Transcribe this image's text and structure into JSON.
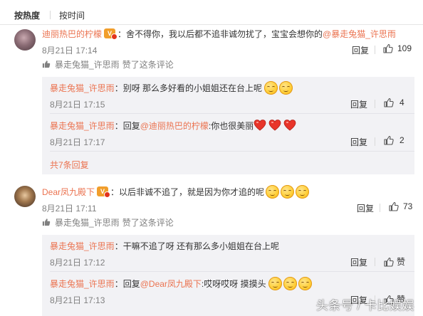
{
  "sort_tabs": [
    {
      "label": "按热度",
      "active": true
    },
    {
      "label": "按时间",
      "active": false
    }
  ],
  "comments": [
    {
      "user": "迪丽热巴的柠檬",
      "text": "舍不得你，我以后都不追非诚勿扰了，宝宝会想你的",
      "mention": "@暴走兔猫_许思雨",
      "time": "8月21日 17:14",
      "reply_label": "回复",
      "likes": "109",
      "upvote_note": {
        "user": "暴走兔猫_许思雨",
        "text": "赞了这条评论"
      },
      "replies": [
        {
          "user": "暴走兔猫_许思雨",
          "text": "别呀 那么多好看的小姐姐还在台上呢",
          "emoji": [
            "smile-emoji",
            "smile-emoji"
          ],
          "time": "8月21日 17:15",
          "reply_label": "回复",
          "likes": "4"
        },
        {
          "user": "暴走兔猫_许思雨",
          "reply_prefix": "回复",
          "mention": "@迪丽热巴的柠檬",
          "text": ":你也很美丽",
          "emoji": [
            "heart-emoji",
            "heart-emoji",
            "heart-emoji"
          ],
          "time": "8月21日 17:17",
          "reply_label": "回复",
          "likes": "2"
        }
      ],
      "more_replies": "共7条回复"
    },
    {
      "user": "Dear凤九殿下",
      "text": "以后非诚不追了，就是因为你才追的呢",
      "emoji": [
        "smile-emoji",
        "smile-emoji",
        "smile-emoji"
      ],
      "time": "8月21日 17:11",
      "reply_label": "回复",
      "likes": "73",
      "upvote_note": {
        "user": "暴走兔猫_许思雨",
        "text": "赞了这条评论"
      },
      "replies": [
        {
          "user": "暴走兔猫_许思雨",
          "text": "干嘛不追了呀 还有那么多小姐姐在台上呢",
          "time": "8月21日 17:12",
          "reply_label": "回复",
          "like_label": "赞"
        },
        {
          "user": "暴走兔猫_许思雨",
          "reply_prefix": "回复",
          "mention": "@Dear凤九殿下",
          "text": ":哎呀哎呀 摸摸头",
          "emoji": [
            "smile-emoji",
            "smile-emoji",
            "smile-emoji"
          ],
          "time": "8月21日 17:13",
          "reply_label": "回复",
          "like_label": "赞"
        }
      ]
    }
  ],
  "vip_badge": "V",
  "colon": "：",
  "watermark": "头条号 / 卡比娱娱",
  "colors": {
    "accent": "#eb7350",
    "reply_bg": "#f2f2f5",
    "muted": "#808080"
  }
}
